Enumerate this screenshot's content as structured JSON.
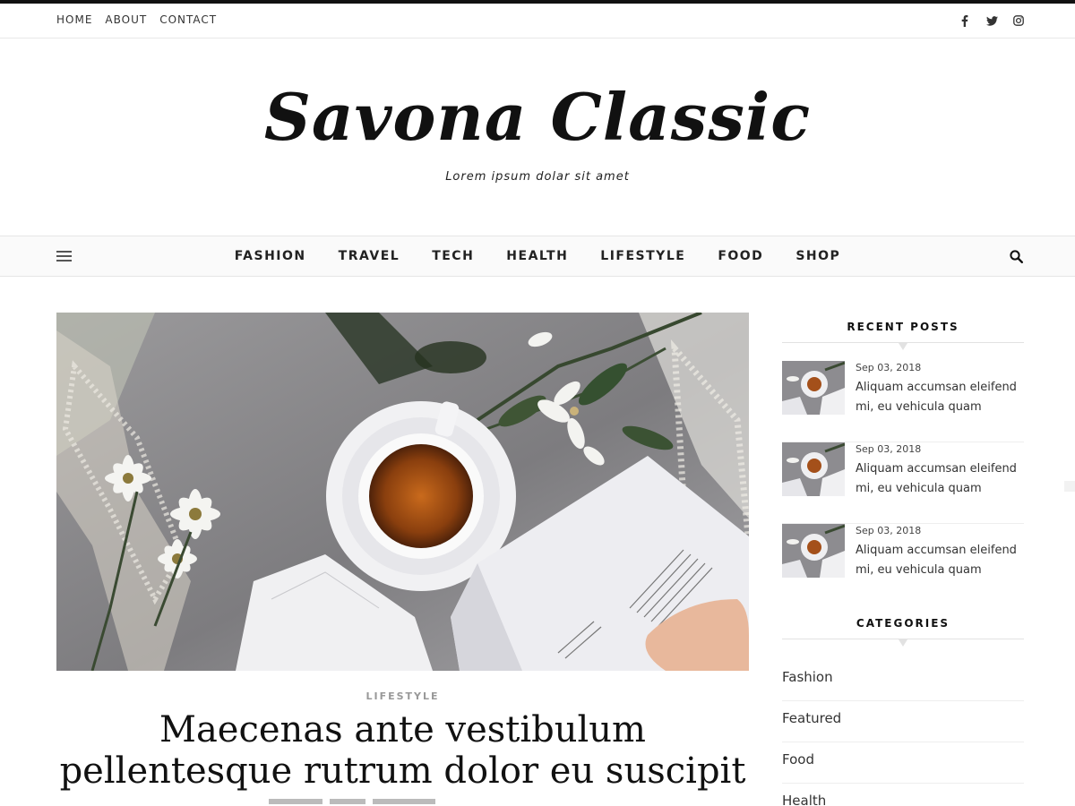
{
  "top_menu": {
    "items": [
      "HOME",
      "ABOUT",
      "CONTACT"
    ]
  },
  "social": {
    "icons": [
      "facebook-icon",
      "twitter-icon",
      "instagram-icon"
    ]
  },
  "brand": {
    "title": "Savona Classic",
    "tagline": "Lorem ipsum dolar sit amet"
  },
  "main_nav": {
    "items": [
      "FASHION",
      "TRAVEL",
      "TECH",
      "HEALTH",
      "LIFESTYLE",
      "FOOD",
      "SHOP"
    ],
    "menu_icon": "hamburger-icon",
    "search_icon": "search-icon"
  },
  "post": {
    "category": "LIFESTYLE",
    "title": "Maecenas ante vestibulum pellentesque rutrum dolor eu suscipit"
  },
  "sidebar": {
    "recent_title": "RECENT POSTS",
    "recent_posts": [
      {
        "date": "Sep 03, 2018",
        "title": "Aliquam accumsan eleifend mi, eu vehicula quam"
      },
      {
        "date": "Sep 03, 2018",
        "title": "Aliquam accumsan eleifend mi, eu vehicula quam"
      },
      {
        "date": "Sep 03, 2018",
        "title": "Aliquam accumsan eleifend mi, eu vehicula quam"
      }
    ],
    "categories_title": "CATEGORIES",
    "categories": [
      "Fashion",
      "Featured",
      "Food",
      "Health"
    ]
  },
  "colors": {
    "accent": "#111111",
    "text": "#222222",
    "muted": "#999999"
  }
}
